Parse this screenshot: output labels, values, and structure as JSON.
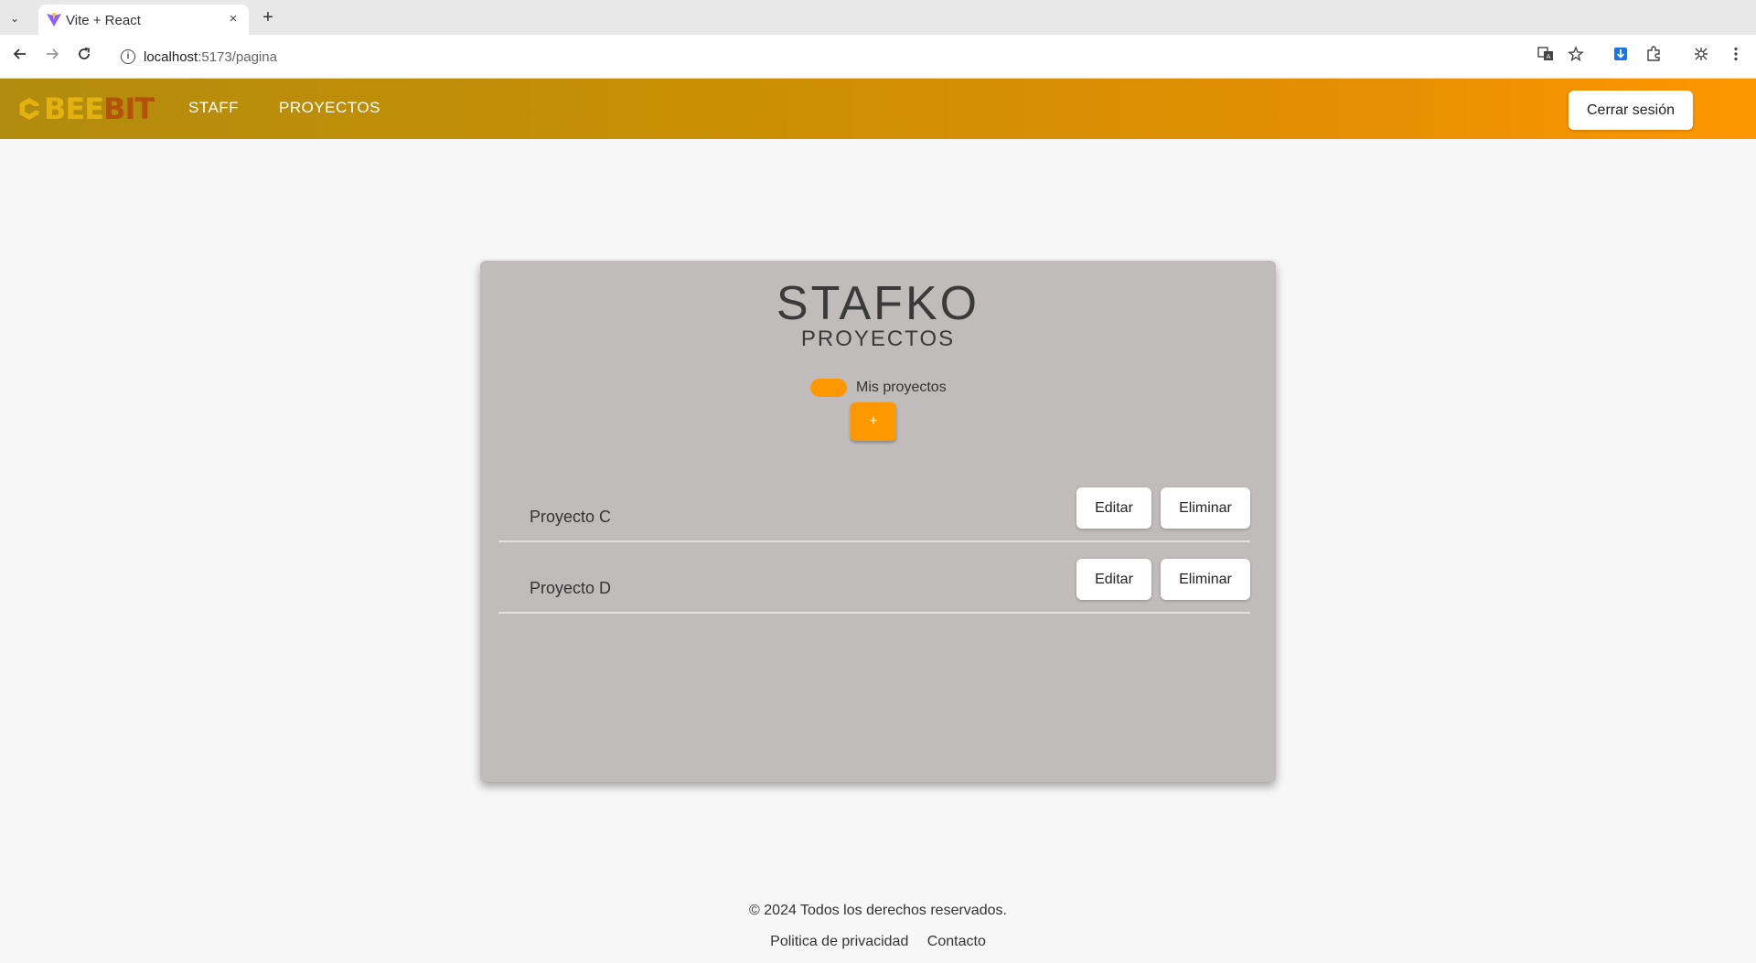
{
  "browser": {
    "tab_title": "Vite + React",
    "tab_close": "×",
    "new_tab": "+",
    "tab_menu": "⌄",
    "url_host": "localhost",
    "url_rest": ":5173/pagina",
    "url_info_icon": "i"
  },
  "header": {
    "logo_part1": "BEE",
    "logo_part2": "BIT",
    "nav": [
      {
        "label": "STAFF"
      },
      {
        "label": "PROYECTOS"
      }
    ],
    "logout_label": "Cerrar sesión",
    "colors": {
      "gradient_start": "#b28c0e",
      "gradient_end": "#ff9600",
      "logo_bee": "#e2b20f",
      "logo_bit": "#b4520c"
    }
  },
  "card": {
    "title": "STAFKO",
    "subtitle": "PROYECTOS",
    "toggle_label": "Mis proyectos",
    "add_label": "+",
    "accent": "#ff9800",
    "projects": [
      {
        "name": "Proyecto C",
        "edit_label": "Editar",
        "delete_label": "Eliminar"
      },
      {
        "name": "Proyecto D",
        "edit_label": "Editar",
        "delete_label": "Eliminar"
      }
    ]
  },
  "footer": {
    "copyright": "© 2024 Todos los derechos reservados.",
    "privacy": "Politica de privacidad",
    "contact": "Contacto"
  }
}
